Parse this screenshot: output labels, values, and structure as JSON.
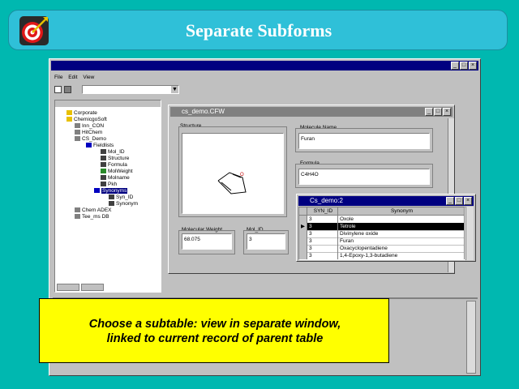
{
  "slide": {
    "title": "Separate Subforms"
  },
  "app": {
    "menu": [
      "File",
      "Edit",
      "View"
    ],
    "tree": [
      "Corporate",
      "ChemicgoSoft",
      "Inn_CON",
      "HitChem",
      "CS_Demo",
      "Fieldlists",
      "Mol_ID",
      "Structure",
      "Formula",
      "MolWeight",
      "Molname",
      "Pkh",
      "Synonyms",
      "Syn_ID",
      "Synonym",
      "Chem ADEX",
      "Tee_ms DB"
    ]
  },
  "form": {
    "title": "cs_demo.CFW",
    "structure_label": "Structure",
    "molname_label": "Molecule Name",
    "molname_value": "Furan",
    "formula_label": "Formula",
    "formula_value": "C4H4O",
    "molweight_label": "Molecular Weight",
    "molweight_value": "68.075",
    "molid_label": "Mol_ID",
    "molid_value": "3"
  },
  "subtable": {
    "title": "Cs_demo:2",
    "headers": [
      "SYN_ID",
      "Synonym"
    ],
    "rows": [
      {
        "id": "3",
        "name": "Oxole"
      },
      {
        "id": "3",
        "name": "Tetrole"
      },
      {
        "id": "3",
        "name": "Divinylene oxide"
      },
      {
        "id": "3",
        "name": "Furan"
      },
      {
        "id": "3",
        "name": "Oxacyclopentadiene"
      },
      {
        "id": "3",
        "name": "1,4-Epoxy-1,3-butadiene"
      }
    ],
    "selected_index": 1
  },
  "callout": {
    "line1": "Choose a subtable: view in separate window,",
    "line2": "linked to current record of parent table"
  },
  "colors": {
    "background": "#00b8b0",
    "banner": "#2fc0d8",
    "callout": "#ffff00",
    "titlebar_active": "#000080"
  }
}
